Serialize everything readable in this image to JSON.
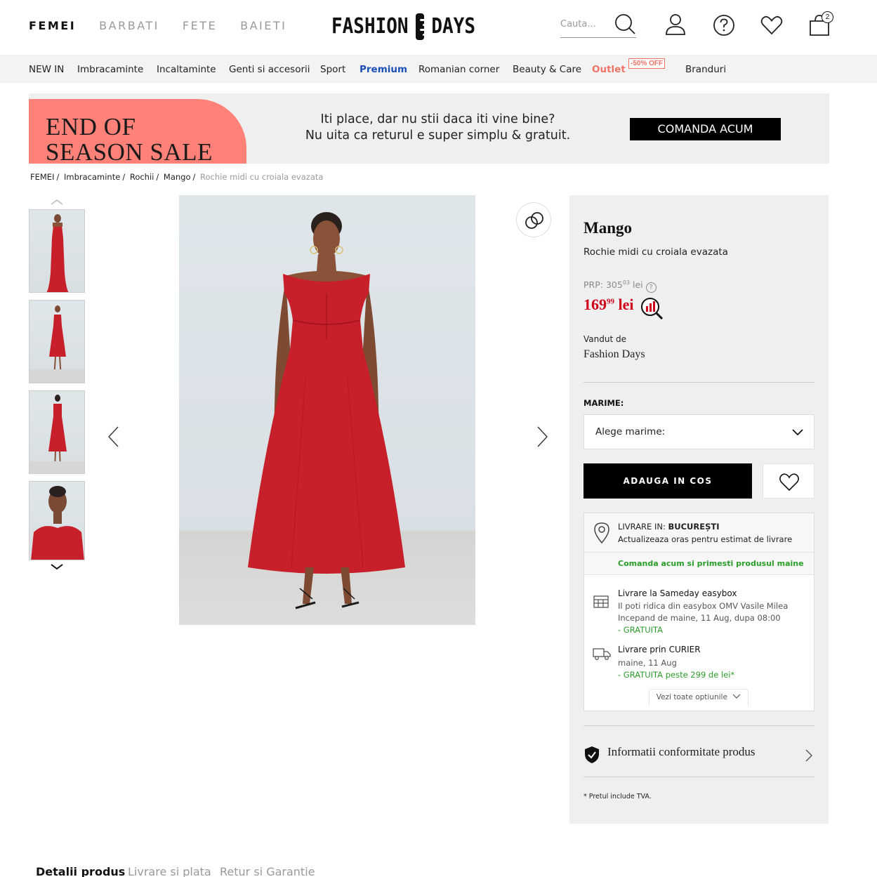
{
  "header": {
    "gender_tabs": [
      "FEMEI",
      "BARBATI",
      "FETE",
      "BAIETI"
    ],
    "logo_left": "FASHION",
    "logo_right": "DAYS",
    "search_placeholder": "Cauta...",
    "cart_count": "2",
    "icons": [
      "search-icon",
      "account-icon",
      "help-icon",
      "heart-icon",
      "cart-icon"
    ]
  },
  "nav": {
    "items": [
      "NEW IN",
      "Imbracaminte",
      "Incaltaminte",
      "Genti si accesorii",
      "Sport",
      "Premium",
      "Romanian corner",
      "Beauty & Care",
      "Outlet",
      "Branduri"
    ],
    "outlet_badge": "-50% OFF",
    "premium_color": "#1a4fb8",
    "outlet_color": "#f07466"
  },
  "banner": {
    "title_line1": "END OF",
    "title_line2": "SEASON SALE",
    "text_line1": "Iti place, dar nu stii daca iti vine bine?",
    "text_line2": "Nu uita ca returul e super simplu & gratuit.",
    "button": "COMANDA ACUM",
    "accent": "#ff8178"
  },
  "breadcrumb": {
    "items": [
      "FEMEI",
      "Imbracaminte",
      "Rochii",
      "Mango"
    ],
    "current": "Rochie midi cu croiala evazata"
  },
  "product": {
    "brand": "Mango",
    "name": "Rochie midi cu croiala evazata",
    "prp_label": "PRP: 305",
    "prp_cents": "03",
    "prp_currency": "lei",
    "price_main": "169",
    "price_cents": "99",
    "price_currency": "lei",
    "price_color": "#d0021b",
    "sold_by_label": "Vandut de",
    "seller": "Fashion Days",
    "size_label": "MARIME:",
    "size_placeholder": "Alege marime:",
    "add_to_cart": "ADAUGA IN COS",
    "dress_color": "#c8202a"
  },
  "delivery": {
    "city_label": "LIVRARE IN: ",
    "city": "BUCUREȘTI",
    "update_text": "Actualizeaza oras pentru estimat de livrare",
    "promo": "Comanda acum si primesti produsul maine",
    "option1_title": "Livrare la Sameday easybox",
    "option1_line1": "Il poti ridica din easybox OMV Vasile Milea",
    "option1_line2": "Incepand de maine, 11 Aug, dupa 08:00",
    "option1_price": "- GRATUITA",
    "option2_title": "Livrare prin CURIER",
    "option2_line1": "maine, 11 Aug",
    "option2_price": "- GRATUITA peste 299 de lei*",
    "see_all": "Vezi toate optiunile"
  },
  "compliance": {
    "label": "Informatii conformitate produs",
    "vat_note": "* Pretul include TVA."
  },
  "bottom_tabs": [
    "Detalii produs",
    "Livrare si plata",
    "Retur si Garantie"
  ]
}
